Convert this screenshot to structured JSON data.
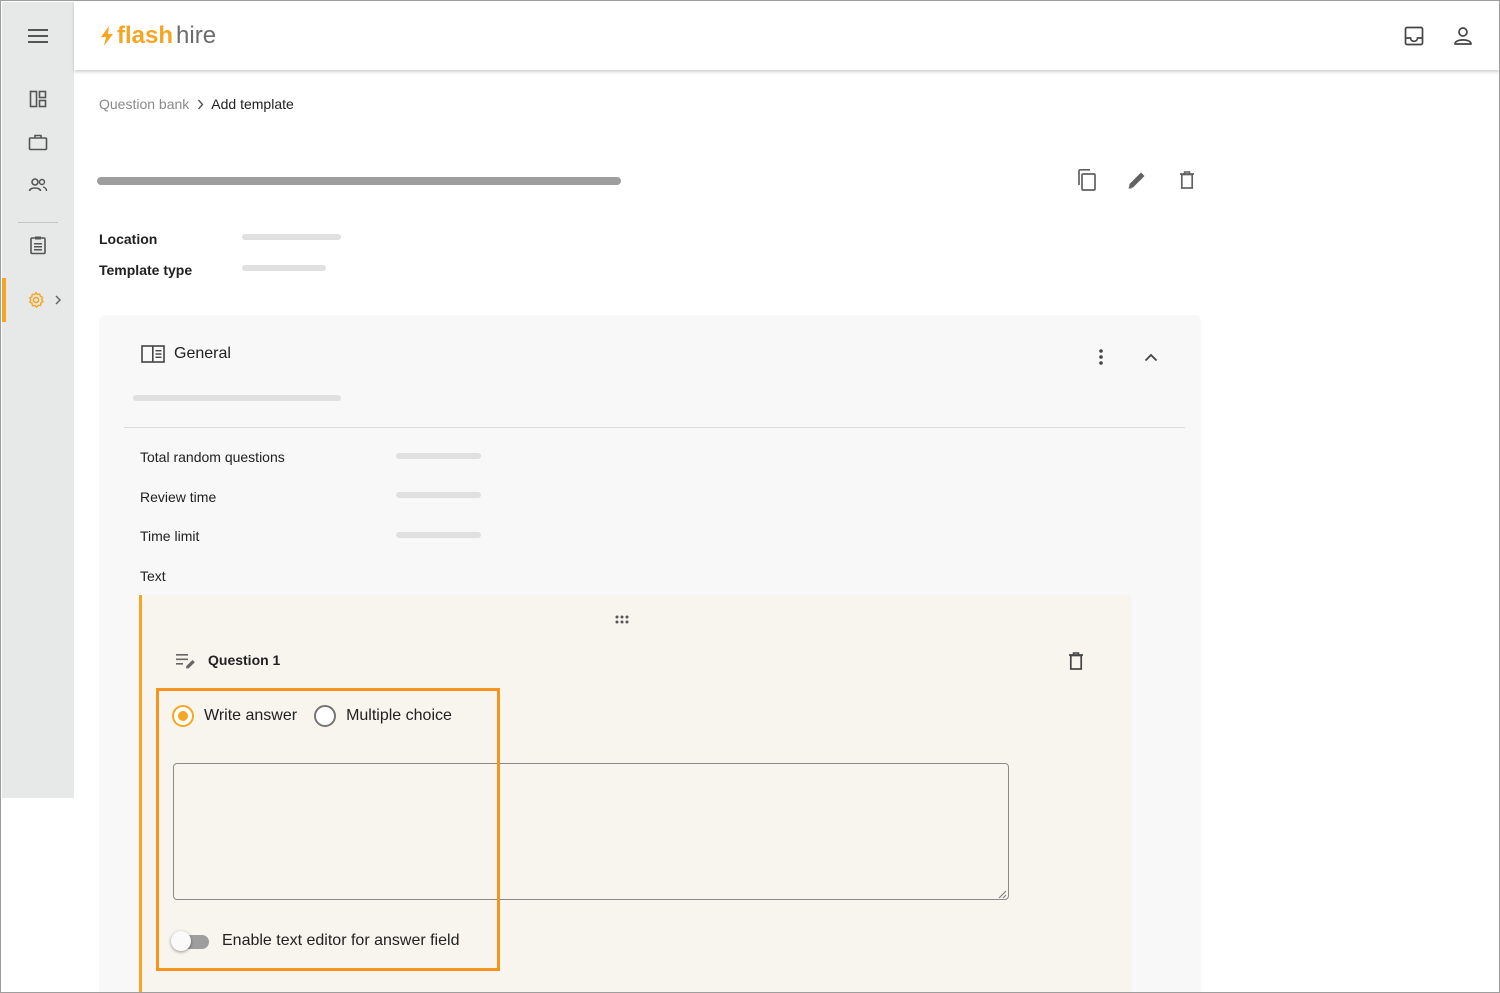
{
  "app": {
    "logo_flash": "flash",
    "logo_hire": "hire",
    "accent_color": "#f5a623"
  },
  "sidebar": {
    "items": [
      {
        "icon": "menu-icon"
      },
      {
        "icon": "dashboard-icon"
      },
      {
        "icon": "briefcase-icon"
      },
      {
        "icon": "people-icon"
      },
      {
        "icon": "clipboard-icon"
      },
      {
        "icon": "settings-icon",
        "active": true
      }
    ]
  },
  "topbar": {
    "icons": [
      "inbox-icon",
      "account-icon"
    ]
  },
  "breadcrumb": {
    "parent": "Question bank",
    "current": "Add template"
  },
  "template": {
    "location_label": "Location",
    "type_label": "Template type",
    "actions": [
      "copy-icon",
      "edit-icon",
      "delete-icon"
    ]
  },
  "section": {
    "title": "General",
    "fields": {
      "total_random": "Total random questions",
      "review_time": "Review time",
      "time_limit": "Time limit",
      "text": "Text"
    }
  },
  "question": {
    "title": "Question 1",
    "answer_types": {
      "write": "Write answer",
      "multiple": "Multiple choice"
    },
    "selected": "Write answer",
    "answer_value": "",
    "toggle_label": "Enable text editor for answer field",
    "toggle_on": false
  }
}
